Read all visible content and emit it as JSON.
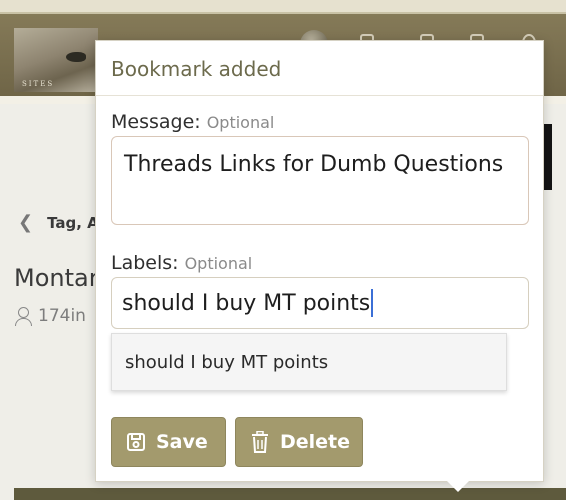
{
  "background": {
    "breadcrumb_label": "Tag, A",
    "thread_title_partial": "Montar",
    "thread_meta_partial": "174in",
    "banner_text": "SITES"
  },
  "popup": {
    "title": "Bookmark added",
    "message_label": "Message:",
    "message_optional": "Optional",
    "message_value": "Threads Links for Dumb Questions",
    "labels_label": "Labels:",
    "labels_optional": "Optional",
    "labels_value": "should I buy MT points",
    "suggestion": "should I buy MT points",
    "save_label": "Save",
    "delete_label": "Delete"
  },
  "icons": {
    "menu": "hamburger-icon",
    "back": "chevron-left-icon",
    "user": "user-icon",
    "save": "floppy-disk-icon",
    "delete": "trash-icon"
  },
  "colors": {
    "navbar": "#7b7050",
    "accent_button": "#a39a6d",
    "title_text": "#6c6a4c",
    "caret": "#3b6fd6"
  }
}
